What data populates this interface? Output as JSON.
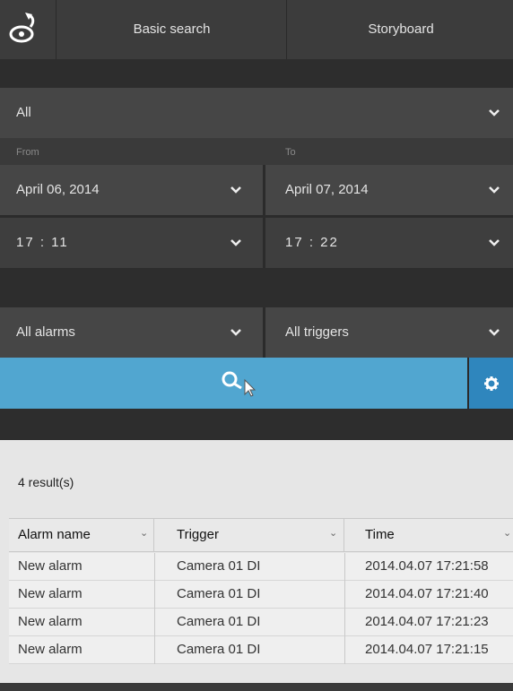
{
  "topbar": {
    "back_icon": "back-arrow-icon",
    "tab1": "Basic search",
    "tab2": "Storyboard"
  },
  "camera_select": {
    "value": "All"
  },
  "range": {
    "from_label": "From",
    "to_label": "To",
    "from_date": "April 06, 2014",
    "to_date": "April 07, 2014",
    "from_time": "17 : 11",
    "to_time": "17 : 22"
  },
  "filters": {
    "alarms": "All alarms",
    "triggers": "All triggers"
  },
  "search": {
    "button_icon": "search-cursor-icon",
    "settings_icon": "gear-icon"
  },
  "results": {
    "count_text": "4 result(s)",
    "columns": [
      "Alarm name",
      "Trigger",
      "Time"
    ],
    "rows": [
      [
        "New alarm",
        "Camera 01 DI",
        "2014.04.07 17:21:58"
      ],
      [
        "New alarm",
        "Camera 01 DI",
        "2014.04.07 17:21:40"
      ],
      [
        "New alarm",
        "Camera 01 DI",
        "2014.04.07 17:21:23"
      ],
      [
        "New alarm",
        "Camera 01 DI",
        "2014.04.07 17:21:15"
      ]
    ]
  },
  "colors": {
    "accent": "#51a6d0",
    "accent_dark": "#2f86bd",
    "panel": "#3a3a3a",
    "results_bg": "#e6e6e6"
  }
}
